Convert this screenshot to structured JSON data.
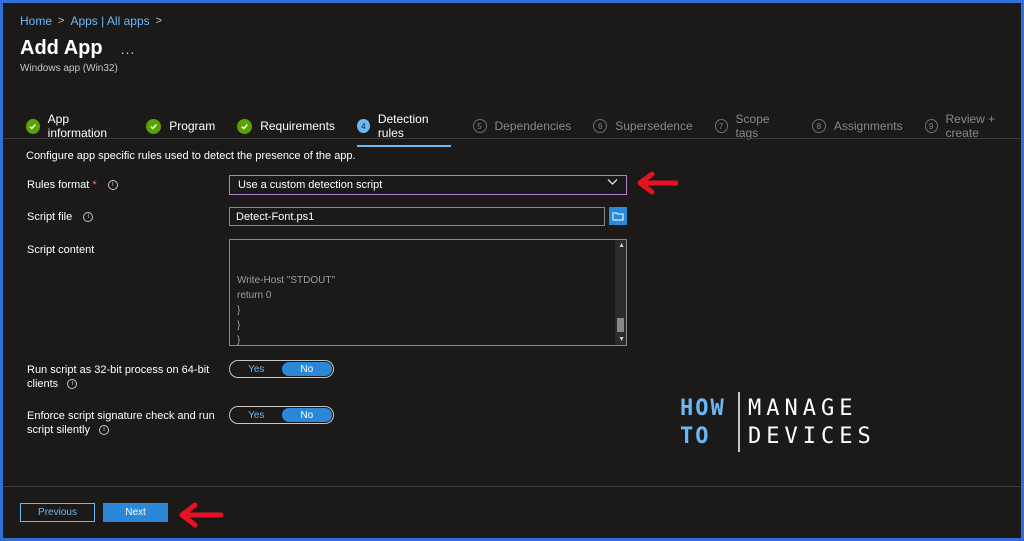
{
  "breadcrumb": [
    {
      "label": "Home"
    },
    {
      "label": "Apps | All apps"
    }
  ],
  "page": {
    "title": "Add App",
    "more": "...",
    "subtitle": "Windows app (Win32)"
  },
  "steps": [
    {
      "label": "App information",
      "state": "done",
      "num": ""
    },
    {
      "label": "Program",
      "state": "done",
      "num": ""
    },
    {
      "label": "Requirements",
      "state": "done",
      "num": ""
    },
    {
      "label": "Detection rules",
      "state": "active",
      "num": "4"
    },
    {
      "label": "Dependencies",
      "state": "todo",
      "num": "5"
    },
    {
      "label": "Supersedence",
      "state": "todo",
      "num": "6"
    },
    {
      "label": "Scope tags",
      "state": "todo",
      "num": "7"
    },
    {
      "label": "Assignments",
      "state": "todo",
      "num": "8"
    },
    {
      "label": "Review + create",
      "state": "todo",
      "num": "9"
    }
  ],
  "form": {
    "description": "Configure app specific rules used to detect the presence of the app.",
    "rules_format_label": "Rules format",
    "required_mark": "*",
    "rules_format_value": "Use a custom detection script",
    "script_file_label": "Script file",
    "script_file_value": "Detect-Font.ps1",
    "script_content_label": "Script content",
    "script_lines": [
      "Write-Host \"STDOUT\"",
      "return 0",
      "}",
      "}",
      "}"
    ],
    "run32_label_line1": "Run script as 32-bit process on 64-bit",
    "run32_label_line2": "clients",
    "enforce_label_line1": "Enforce script signature check and run",
    "enforce_label_line2": "script silently",
    "toggle_yes": "Yes",
    "toggle_no": "No",
    "run32_value": "No",
    "enforce_value": "No"
  },
  "logo": {
    "how": "HOW",
    "to": "TO",
    "manage": "MANAGE",
    "devices": "DEVICES"
  },
  "footer": {
    "previous_label": "Previous",
    "next_label": "Next"
  },
  "colors": {
    "accent": "#2b88d8",
    "link": "#6cb8f6",
    "success": "#57a300",
    "annotation_arrow": "#e81123",
    "frame": "#2f6fd6"
  },
  "icons": {
    "done_step": "checkmark-circle-icon",
    "info": "info-icon",
    "dropdown": "chevron-down-icon",
    "browse": "folder-icon",
    "annotation": "red-arrow-icon"
  }
}
